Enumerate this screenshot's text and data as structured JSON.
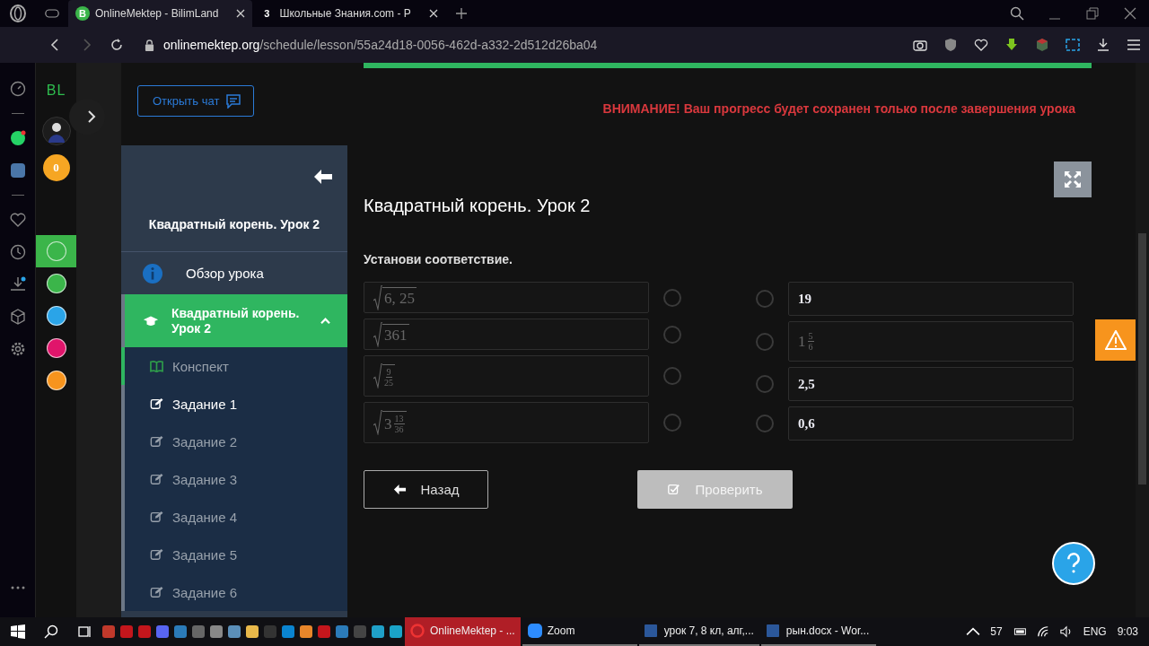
{
  "browser": {
    "tabs": [
      {
        "label": "OnlineMektep - BilimLand",
        "icon_text": "B",
        "selected": true
      },
      {
        "label": "Школьные Знания.com - P",
        "icon_text": "3",
        "selected": false
      }
    ],
    "url_host": "onlinemektep.org",
    "url_path": "/schedule/lesson/55a24d18-0056-462d-a332-2d512d26ba04"
  },
  "bl_sidebar": {
    "logo": "BL",
    "coins": "0",
    "apps": [
      {
        "color": "#3bb54a",
        "selected": true
      },
      {
        "color": "#3bb54a",
        "selected": false
      },
      {
        "color": "#2aa4e8",
        "selected": false
      },
      {
        "color": "#e0156b",
        "selected": false
      },
      {
        "color": "#f7941d",
        "selected": false
      }
    ]
  },
  "chat_button": "Открыть чат",
  "progress": {
    "level": 1
  },
  "lesson_nav": {
    "title": "Квадратный корень. Урок 2",
    "overview": "Обзор урока",
    "section": {
      "label": "Квадратный корень. Урок 2",
      "expanded": true
    },
    "items": [
      {
        "kind": "notes",
        "label": "Конспект",
        "selected": false,
        "completed": true
      },
      {
        "kind": "task",
        "label": "Задание 1",
        "selected": true,
        "completed": false
      },
      {
        "kind": "task",
        "label": "Задание 2",
        "selected": false,
        "completed": false
      },
      {
        "kind": "task",
        "label": "Задание 3",
        "selected": false,
        "completed": false
      },
      {
        "kind": "task",
        "label": "Задание 4",
        "selected": false,
        "completed": false
      },
      {
        "kind": "task",
        "label": "Задание 5",
        "selected": false,
        "completed": false
      },
      {
        "kind": "task",
        "label": "Задание 6",
        "selected": false,
        "completed": false
      }
    ]
  },
  "warning": "ВНИМАНИЕ! Ваш прогресс будет сохранен только после завершения урока",
  "lesson_title": "Квадратный корень. Урок 2",
  "instruction": "Установи соответствие.",
  "left_items": [
    {
      "kind": "sqrt",
      "whole": "6, 25",
      "selected": false
    },
    {
      "kind": "sqrt",
      "whole": "361",
      "selected": false
    },
    {
      "kind": "sqrt-frac",
      "num": "9",
      "den": "25",
      "selected": false
    },
    {
      "kind": "sqrt-mixed",
      "whole": "3",
      "num": "13",
      "den": "36",
      "selected": false
    }
  ],
  "right_items": [
    {
      "kind": "text",
      "whole": "19",
      "selected": false
    },
    {
      "kind": "mixed",
      "whole": "1",
      "num": "5",
      "den": "6",
      "selected": false
    },
    {
      "kind": "text",
      "whole": "2,5",
      "selected": false
    },
    {
      "kind": "text",
      "whole": "0,6",
      "selected": false
    }
  ],
  "back_button": "Назад",
  "check_button": {
    "label": "Проверить",
    "disabled": true
  },
  "taskbar": {
    "windows": [
      {
        "kind": "opera",
        "label": "OnlineMektep - ...",
        "selected": true
      },
      {
        "kind": "zoom",
        "label": "Zoom",
        "selected": false
      },
      {
        "kind": "word",
        "label": "урок 7, 8 кл, алг,...",
        "selected": false
      },
      {
        "kind": "word",
        "label": "рын.docx - Wor...",
        "selected": false
      }
    ],
    "tray_number": "57",
    "language": "ENG",
    "time": "9:03"
  }
}
